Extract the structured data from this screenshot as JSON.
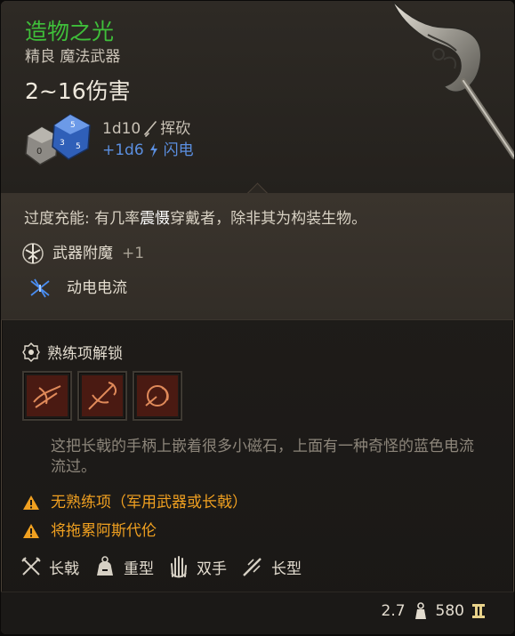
{
  "item": {
    "name": "造物之光",
    "subtitle": "精良 魔法武器",
    "damage": "2~16伤害",
    "damage_lines": [
      {
        "dice": "1d10",
        "type": "挥砍",
        "icon": "slash-icon",
        "color": "#c9c2b6"
      },
      {
        "dice": "+1d6",
        "type": "闪电",
        "icon": "lightning-icon",
        "color": "#5b8fe0"
      }
    ]
  },
  "passive": {
    "prefix": "过度充能: 有几率",
    "highlight": "震慑",
    "suffix": "穿戴者，除非其为构装生物。"
  },
  "enchantments": [
    {
      "label": "武器附魔",
      "value": "+1",
      "icon": "enchant-sword-icon"
    },
    {
      "label": "动电电流",
      "value": "",
      "icon": "spark-icon"
    }
  ],
  "proficiency": {
    "title": "熟练项解锁",
    "slots": [
      "action-slot-1",
      "action-slot-2",
      "action-slot-3"
    ]
  },
  "description": "这把长戟的手柄上嵌着很多小磁石，上面有一种奇怪的蓝色电流流过。",
  "warnings": [
    {
      "text": "无熟练项（军用武器或长戟）"
    },
    {
      "text": "将拖累阿斯代伦"
    }
  ],
  "properties": [
    {
      "label": "长戟",
      "icon": "halberd-icon"
    },
    {
      "label": "重型",
      "icon": "heavy-icon"
    },
    {
      "label": "双手",
      "icon": "two-handed-icon"
    },
    {
      "label": "长型",
      "icon": "reach-icon"
    }
  ],
  "footer": {
    "weight": "2.7",
    "price": "580"
  },
  "colors": {
    "rarity_green": "#3fbf3a",
    "lightning_blue": "#5b8fe0",
    "warning_orange": "#f0a020"
  }
}
